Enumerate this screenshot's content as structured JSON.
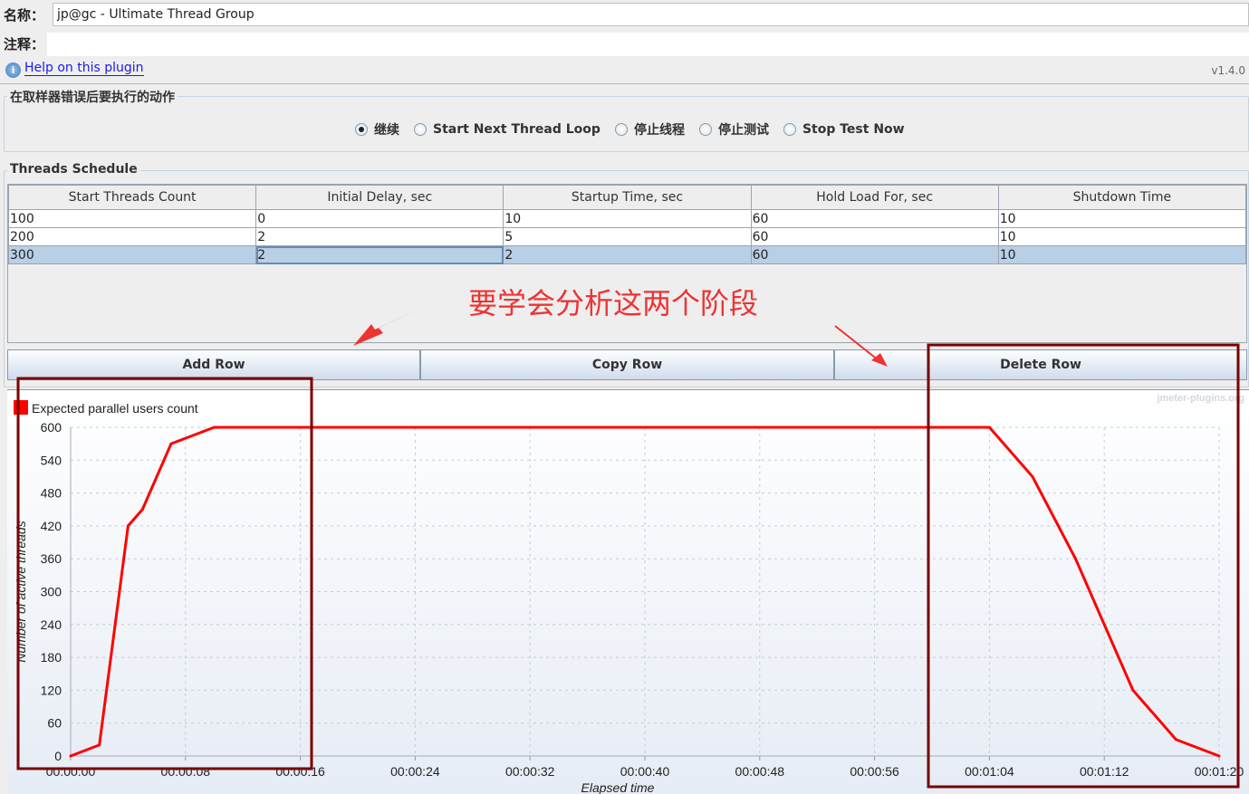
{
  "form": {
    "name_label": "名称：",
    "name_value": "jp@gc - Ultimate Thread Group",
    "comment_label": "注释：",
    "comment_value": "",
    "help_link": "Help on this plugin",
    "version": "v1.4.0"
  },
  "error_action": {
    "title": "在取样器错误后要执行的动作",
    "options": [
      {
        "label": "继续",
        "selected": true
      },
      {
        "label": "Start Next Thread Loop",
        "selected": false
      },
      {
        "label": "停止线程",
        "selected": false
      },
      {
        "label": "停止测试",
        "selected": false
      },
      {
        "label": "Stop Test Now",
        "selected": false
      }
    ]
  },
  "schedule": {
    "title": "Threads Schedule",
    "columns": [
      "Start Threads Count",
      "Initial Delay, sec",
      "Startup Time, sec",
      "Hold Load For, sec",
      "Shutdown Time"
    ],
    "rows": [
      [
        "100",
        "0",
        "10",
        "60",
        "10"
      ],
      [
        "200",
        "2",
        "5",
        "60",
        "10"
      ],
      [
        "300",
        "2",
        "2",
        "60",
        "10"
      ]
    ],
    "selected_row": 2,
    "buttons": {
      "add": "Add Row",
      "copy": "Copy Row",
      "delete": "Delete Row"
    }
  },
  "annotation": {
    "text": "要学会分析这两个阶段",
    "color": "#ee3333",
    "box_color": "#7a0000"
  },
  "chart_data": {
    "type": "line",
    "watermark": "jmeter-plugins.org",
    "xlabel": "Elapsed time",
    "ylabel": "Number of active threads",
    "xlim": [
      0,
      80
    ],
    "ylim": [
      0,
      600
    ],
    "grid": true,
    "legend_placement": "top-left",
    "x_ticks": [
      0,
      8,
      16,
      24,
      32,
      40,
      48,
      56,
      64,
      72,
      80
    ],
    "x_tick_labels": [
      "00:00:00",
      "00:00:08",
      "00:00:16",
      "00:00:24",
      "00:00:32",
      "00:00:40",
      "00:00:48",
      "00:00:56",
      "00:01:04",
      "00:01:12",
      "00:01:20"
    ],
    "y_ticks": [
      0,
      60,
      120,
      180,
      240,
      300,
      360,
      420,
      480,
      540,
      600
    ],
    "series": [
      {
        "name": "Expected parallel users count",
        "color": "#ff0000",
        "x": [
          0,
          2,
          4,
          5,
          7,
          10,
          64,
          67,
          70,
          74,
          77,
          80
        ],
        "y": [
          0,
          20,
          420,
          450,
          570,
          600,
          600,
          510,
          360,
          120,
          30,
          0
        ]
      }
    ]
  }
}
